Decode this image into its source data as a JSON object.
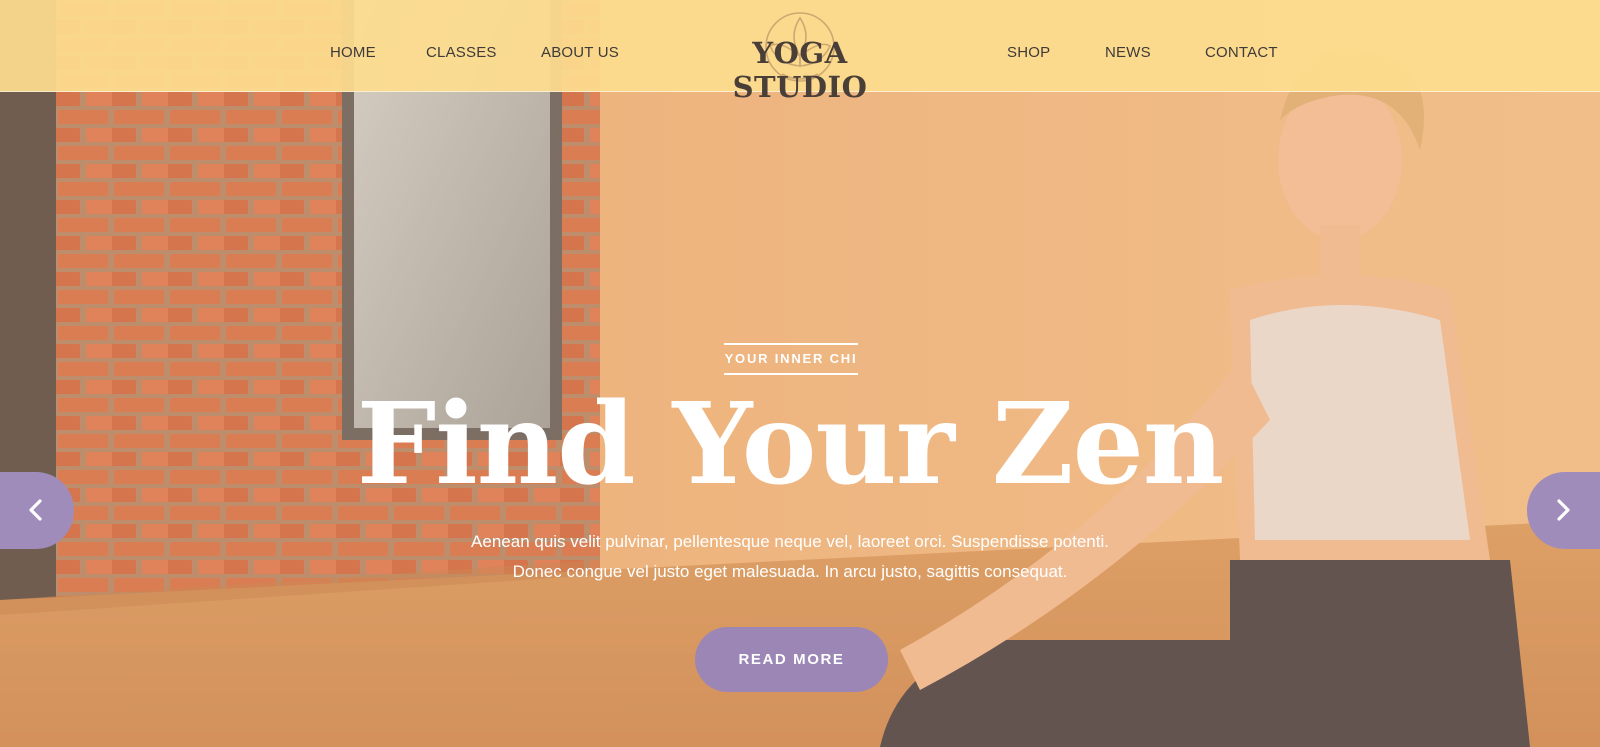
{
  "header": {
    "logo_text": "YOGA STUDIO",
    "nav_left": [
      "HOME",
      "CLASSES",
      "ABOUT US"
    ],
    "nav_right": [
      "SHOP",
      "NEWS",
      "CONTACT"
    ]
  },
  "hero": {
    "eyebrow": "YOUR INNER CHI",
    "headline": "Find Your Zen",
    "subtext_line1": "Aenean quis velit pulvinar, pellentesque neque vel, laoreet orci. Suspendisse potenti.",
    "subtext_line2": "Donec congue vel justo eget malesuada. In arcu justo, sagittis consequat.",
    "cta_label": "READ MORE"
  },
  "slider": {
    "prev_icon": "chevron-left-icon",
    "next_icon": "chevron-right-icon"
  },
  "colors": {
    "header_bg": "#fddd8e",
    "accent_purple": "#9b86b5",
    "text_dark": "#3f3a3a",
    "text_light": "#ffffff"
  }
}
